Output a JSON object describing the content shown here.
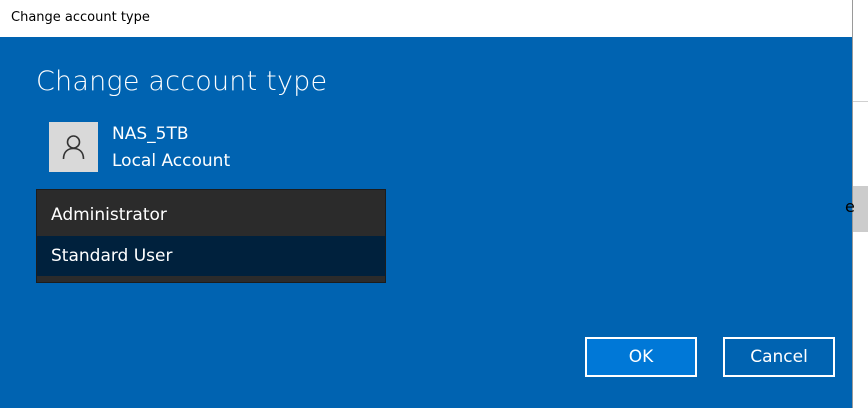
{
  "window": {
    "title": "Change account type"
  },
  "dialog": {
    "heading": "Change account type",
    "account": {
      "name": "NAS_5TB",
      "type": "Local Account",
      "icon": "user-icon"
    },
    "account_type_options": [
      {
        "label": "Administrator",
        "selected": false
      },
      {
        "label": "Standard User",
        "selected": true
      }
    ],
    "buttons": {
      "ok_label": "OK",
      "cancel_label": "Cancel"
    }
  },
  "background": {
    "peek_char": "e"
  },
  "colors": {
    "dialog_blue": "#0063b1",
    "ok_button_blue": "#0078d7",
    "list_background": "#2b2b2b",
    "selected_option": "#00213d",
    "avatar_background": "#d9d9d9"
  }
}
